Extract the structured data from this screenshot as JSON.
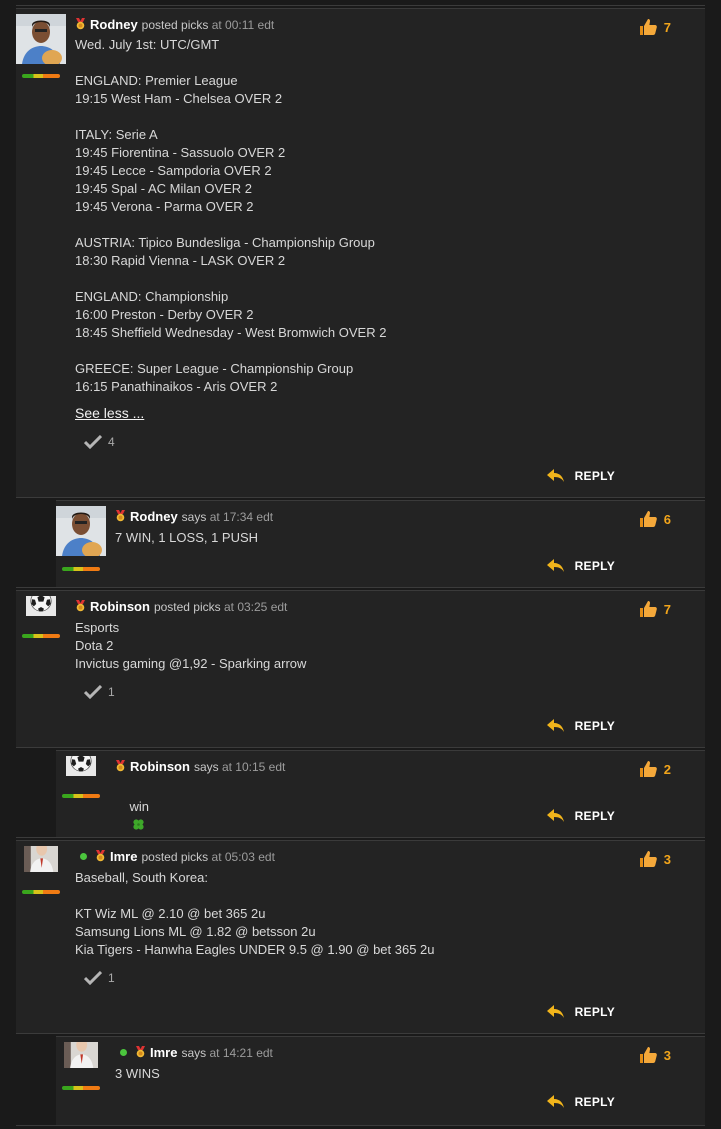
{
  "posts": [
    {
      "name": "Rodney",
      "action": "posted picks",
      "time": "at 00:11 edt",
      "likes": "7",
      "body": "Wed. July 1st: UTC/GMT\n\nENGLAND: Premier League\n19:15 West Ham - Chelsea OVER 2\n\nITALY: Serie A\n19:45 Fiorentina - Sassuolo OVER 2\n19:45 Lecce - Sampdoria OVER 2\n19:45 Spal - AC Milan OVER 2\n19:45 Verona - Parma OVER 2\n\nAUSTRIA: Tipico Bundesliga - Championship Group\n18:30 Rapid Vienna - LASK OVER 2\n\nENGLAND: Championship\n16:00 Preston - Derby OVER 2\n18:45 Sheffield Wednesday - West Bromwich OVER 2\n\nGREECE: Super League - Championship Group\n16:15 Panathinaikos - Aris OVER 2",
      "see_less": "See less ...",
      "checks": "4",
      "reply": "REPLY"
    },
    {
      "name": "Rodney",
      "action": "says",
      "time": "at 17:34 edt",
      "likes": "6",
      "body": "7 WIN, 1 LOSS, 1 PUSH",
      "reply": "REPLY"
    },
    {
      "name": "Robinson",
      "action": "posted picks",
      "time": "at 03:25 edt",
      "likes": "7",
      "body": "Esports\nDota 2\nInvictus gaming @1,92 - Sparking arrow",
      "checks": "1",
      "reply": "REPLY"
    },
    {
      "name": "Robinson",
      "action": "says",
      "time": "at 10:15 edt",
      "likes": "2",
      "body": "win",
      "body_icon": "four-leaf-clover-icon",
      "reply": "REPLY"
    },
    {
      "name": "Imre",
      "action": "posted picks",
      "time": "at 05:03 edt",
      "likes": "3",
      "body": "Baseball, South Korea:\n\nKT Wiz ML @ 2.10 @ bet 365 2u\nSamsung Lions ML @ 1.82 @ betsson 2u\nKia Tigers - Hanwha Eagles UNDER 9.5 @ 1.90 @ bet 365 2u",
      "checks": "1",
      "reply": "REPLY"
    },
    {
      "name": "Imre",
      "action": "says",
      "time": "at 14:21 edt",
      "likes": "3",
      "body": "3 WINS",
      "reply": "REPLY"
    }
  ],
  "colors": {
    "accent": "#f2a51b",
    "online": "#4bc53d",
    "background": "#1a1a1a",
    "panel": "#232323"
  },
  "icons": {
    "like": "thumbs-up-icon",
    "reply": "reply-arrow-icon",
    "check": "checkmark-icon",
    "medal": "medal-icon",
    "online": "online-dot-icon"
  }
}
